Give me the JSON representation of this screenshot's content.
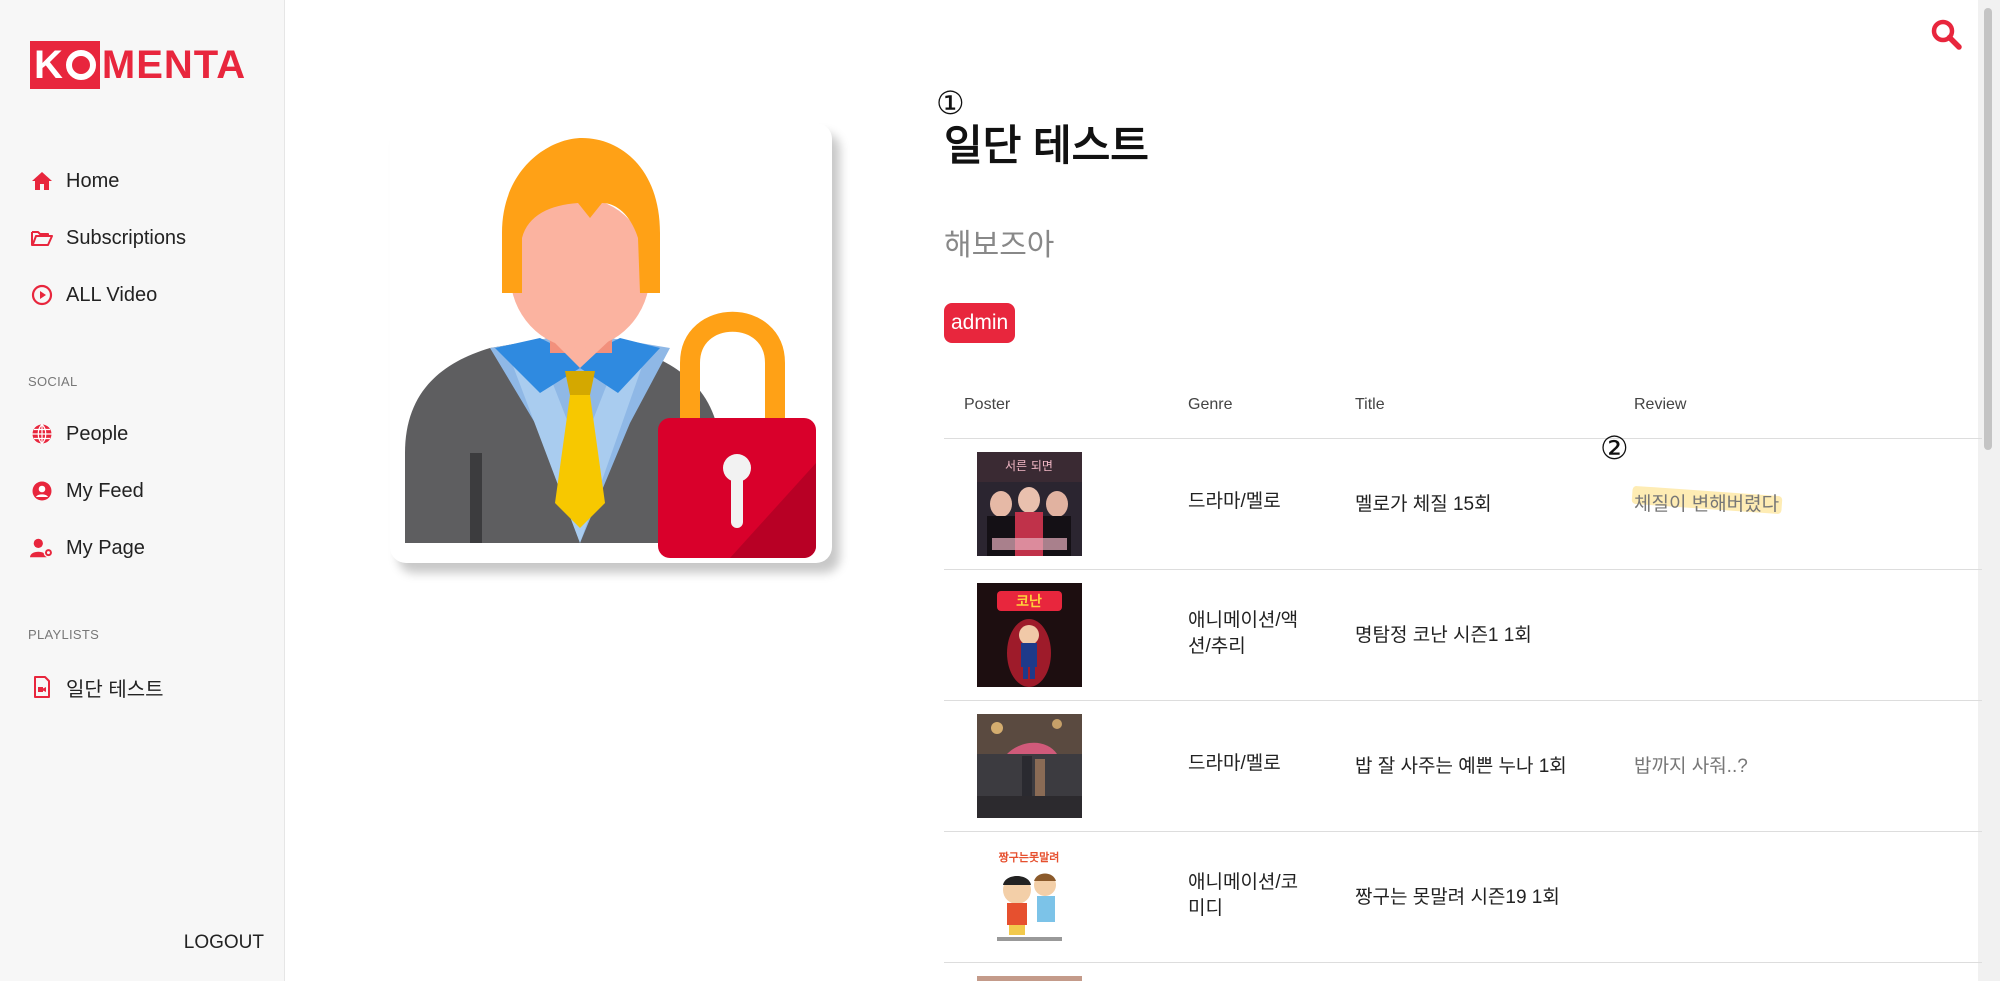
{
  "app": {
    "logo_ko": "K",
    "logo_rest": "MENTA"
  },
  "sidebar": {
    "main_items": [
      {
        "label": "Home",
        "icon": "home-icon"
      },
      {
        "label": "Subscriptions",
        "icon": "folder-open-icon"
      },
      {
        "label": "ALL Video",
        "icon": "play-circle-icon"
      }
    ],
    "social_label": "SOCIAL",
    "social_items": [
      {
        "label": "People",
        "icon": "globe-icon"
      },
      {
        "label": "My Feed",
        "icon": "user-circle-icon"
      },
      {
        "label": "My Page",
        "icon": "user-gear-icon"
      }
    ],
    "playlists_label": "PLAYLISTS",
    "playlist_items": [
      {
        "label": "일단 테스트",
        "icon": "file-video-icon"
      }
    ],
    "logout_label": "LOGOUT"
  },
  "playlist": {
    "marker_1": "①",
    "title": "일단 테스트",
    "description": "해보즈아",
    "owner_badge": "admin"
  },
  "table": {
    "headers": {
      "poster": "Poster",
      "genre": "Genre",
      "title": "Title",
      "review": "Review"
    },
    "marker_2": "②",
    "rows": [
      {
        "genre": "드라마/멜로",
        "title": "멜로가 체질 15회",
        "review": "체질이 변해버렸다",
        "poster_colors": [
          "#2b2530",
          "#c0324a"
        ]
      },
      {
        "genre": "애니메이션/액션/추리",
        "title": "명탐정 코난 시즌1 1회",
        "review": "",
        "poster_colors": [
          "#1d0e10",
          "#9e1b2a"
        ]
      },
      {
        "genre": "드라마/멜로",
        "title": "밥 잘 사주는 예쁜 누나 1회",
        "review": "밥까지 사줘..?",
        "poster_colors": [
          "#3c3b40",
          "#8a6b55"
        ]
      },
      {
        "genre": "애니메이션/코미디",
        "title": "짱구는 못말려 시즌19 1회",
        "review": "",
        "poster_colors": [
          "#ffffff",
          "#e6502f"
        ]
      }
    ]
  },
  "colors": {
    "accent": "#e8263d",
    "highlight": "#fde082"
  }
}
